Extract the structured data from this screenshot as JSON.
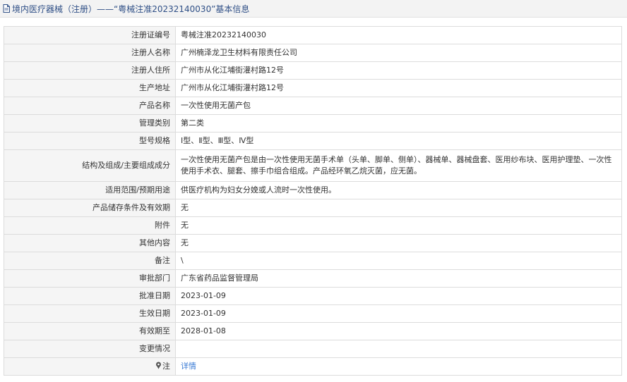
{
  "header": {
    "title": "境内医疗器械（注册）——“粤械注准20232140030”基本信息"
  },
  "rows": [
    {
      "label": "注册证编号",
      "value": "粤械注准20232140030"
    },
    {
      "label": "注册人名称",
      "value": "广州楠泽龙卫生材料有限责任公司"
    },
    {
      "label": "注册人住所",
      "value": "广州市从化江埔街灌村路12号"
    },
    {
      "label": "生产地址",
      "value": "广州市从化江埔街灌村路12号"
    },
    {
      "label": "产品名称",
      "value": "一次性使用无菌产包"
    },
    {
      "label": "管理类别",
      "value": "第二类"
    },
    {
      "label": "型号规格",
      "value": "Ⅰ型、Ⅱ型、Ⅲ型、Ⅳ型"
    },
    {
      "label": "结构及组成/主要组成成分",
      "value": "一次性使用无菌产包是由一次性使用无菌手术单（头单、脚单、侧单）、器械单、器械盘套、医用纱布块、医用护理垫、一次性使用手术衣、腿套、擦手巾组合组成。产品经环氧乙烷灭菌，应无菌。"
    },
    {
      "label": "适用范围/预期用途",
      "value": "供医疗机构为妇女分娩或人流时一次性使用。"
    },
    {
      "label": "产品储存条件及有效期",
      "value": "无"
    },
    {
      "label": "附件",
      "value": "无"
    },
    {
      "label": "其他内容",
      "value": "无"
    },
    {
      "label": "备注",
      "value": "\\"
    },
    {
      "label": "审批部门",
      "value": "广东省药品监督管理局"
    },
    {
      "label": "批准日期",
      "value": "2023-01-09"
    },
    {
      "label": "生效日期",
      "value": "2023-01-09"
    },
    {
      "label": "有效期至",
      "value": "2028-01-08"
    },
    {
      "label": "变更情况",
      "value": ""
    }
  ],
  "note": {
    "label": "注",
    "link": "详情",
    "icon": "pin-icon"
  },
  "colors": {
    "header_text": "#2f4f86",
    "link": "#3a7bd5",
    "label_bg": "#f5f5f5",
    "border": "#dcdcdc"
  }
}
